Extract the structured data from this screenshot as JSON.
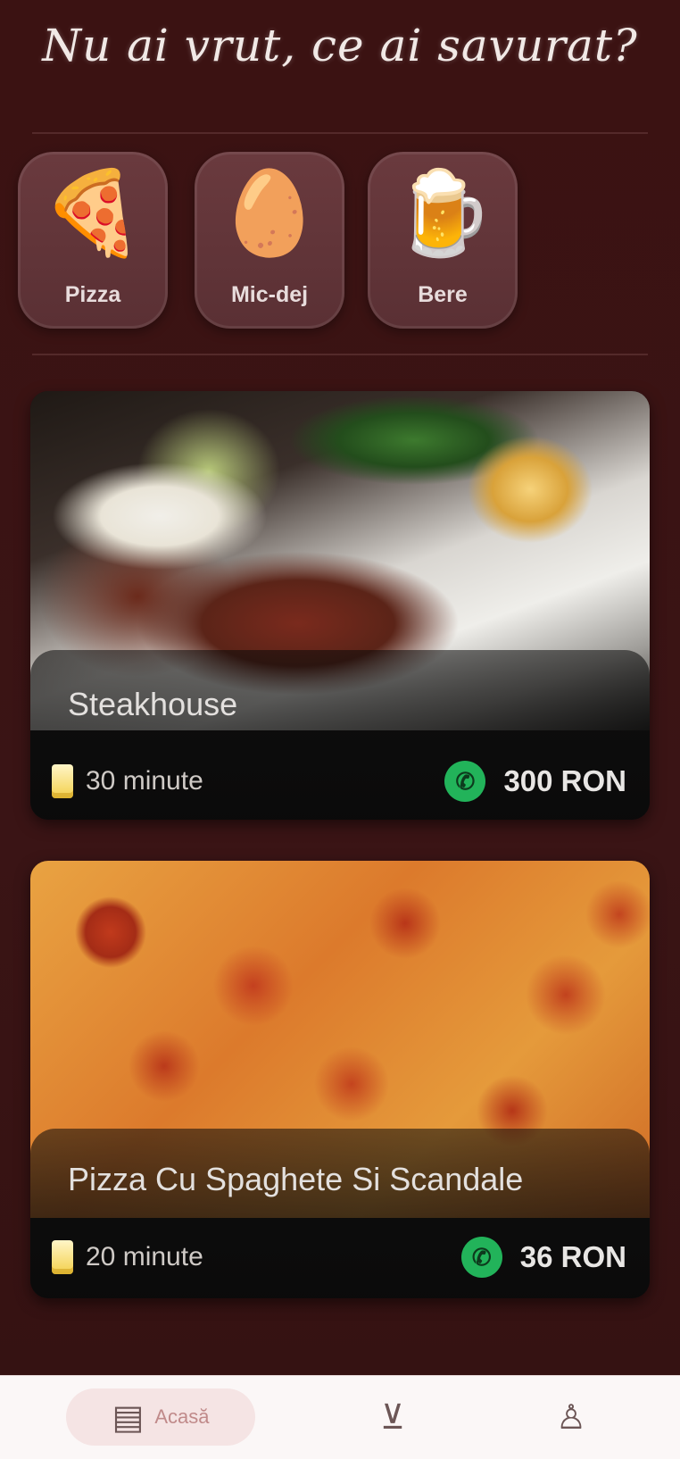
{
  "app": {
    "title": "Nu ai vrut, ce ai savurat?"
  },
  "categories": [
    {
      "label": "Pizza",
      "icon": "pizza-slice-icon",
      "glyph": "🍕"
    },
    {
      "label": "Mic-dej",
      "icon": "breakfast-icon",
      "glyph": "🥚"
    },
    {
      "label": "Bere",
      "icon": "beer-mug-icon",
      "glyph": "🍺"
    }
  ],
  "products": [
    {
      "name": "Steakhouse",
      "time": "30 minute",
      "price": "300 RON"
    },
    {
      "name": "Pizza Cu Spaghete Si Scandale",
      "time": "20 minute",
      "price": "36 RON"
    }
  ],
  "tabs": [
    {
      "label": "Acasă",
      "icon": "home-menu-icon"
    },
    {
      "label": "",
      "icon": "cart-icon"
    },
    {
      "label": "",
      "icon": "profile-icon"
    }
  ],
  "colors": {
    "background": "#3a1313",
    "category_tile": "#643639",
    "call_button": "#22b35a",
    "tabbar": "#fbf7f7"
  }
}
